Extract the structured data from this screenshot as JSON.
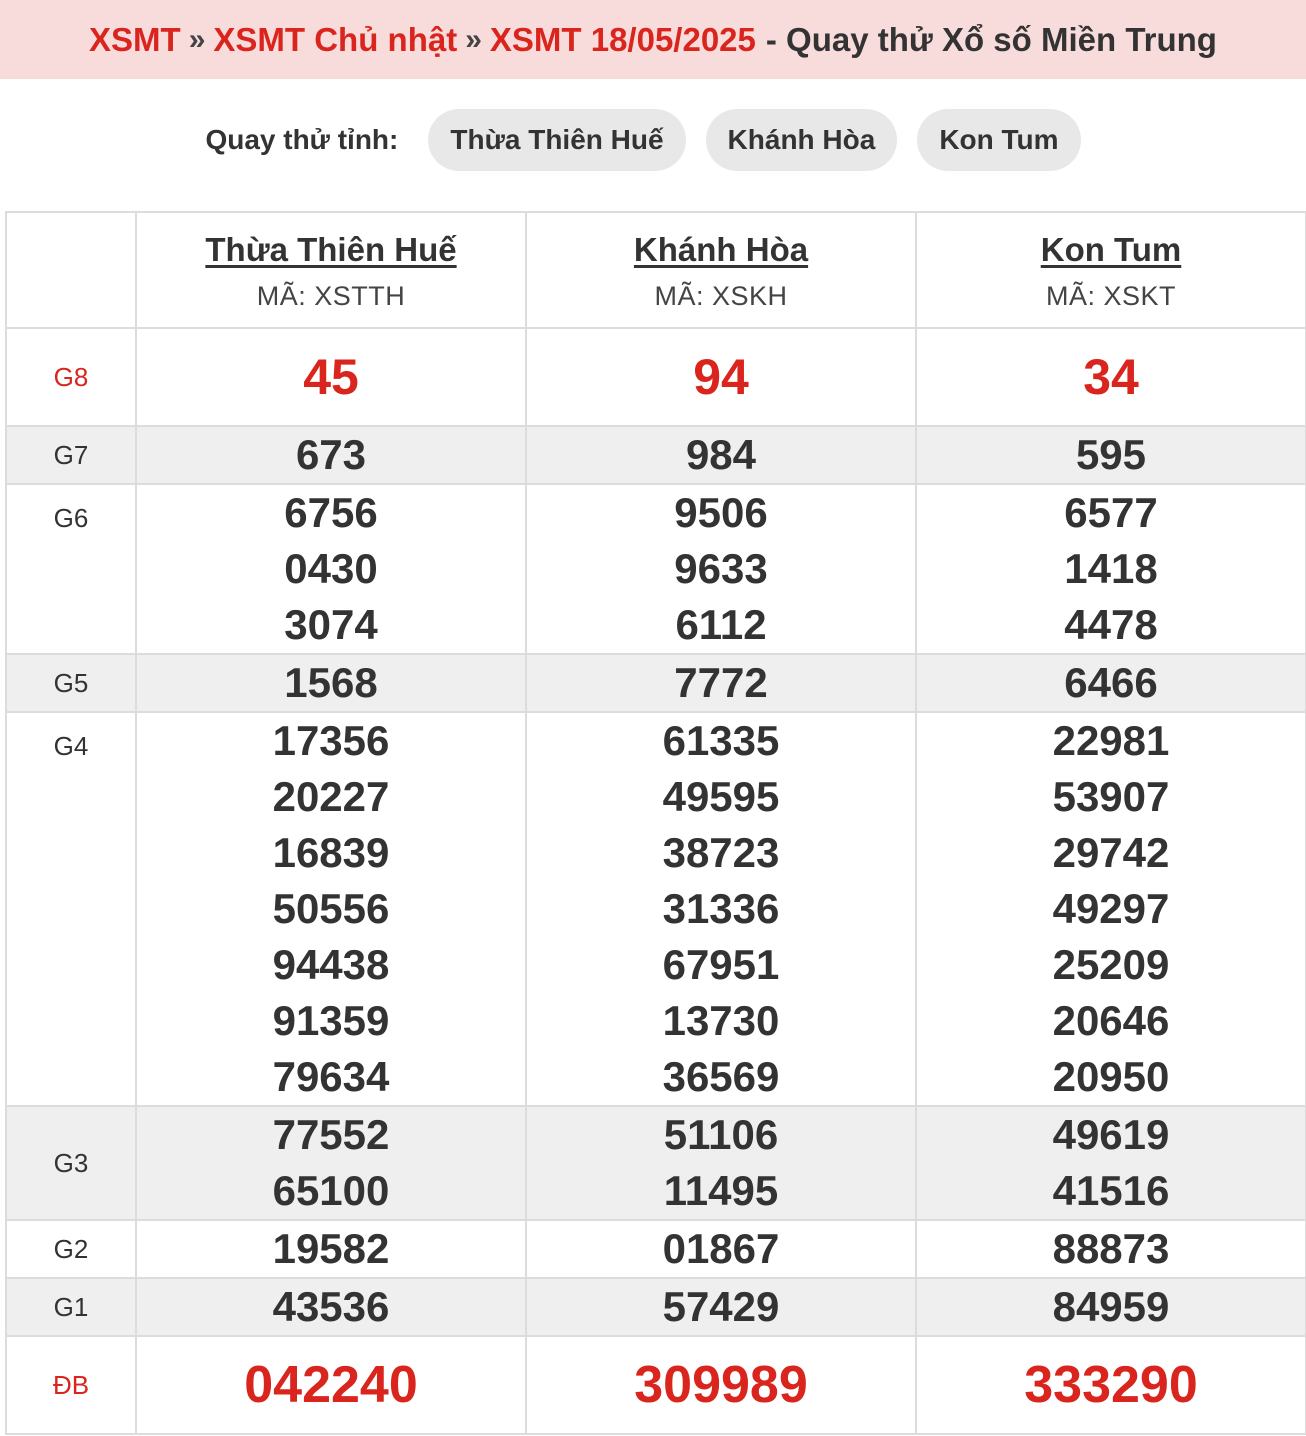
{
  "breadcrumb": {
    "home": "XSMT",
    "sep1": "»",
    "day": "XSMT Chủ nhật",
    "sep2": "»",
    "date": "XSMT 18/05/2025",
    "tail": "- Quay thử Xổ số Miền Trung"
  },
  "chips": {
    "label": "Quay thử tỉnh:",
    "items": [
      "Thừa Thiên Huế",
      "Khánh Hòa",
      "Kon Tum"
    ]
  },
  "provinces": [
    {
      "name": "Thừa Thiên Huế",
      "code": "MÃ: XSTTH"
    },
    {
      "name": "Khánh Hòa",
      "code": "MÃ: XSKH"
    },
    {
      "name": "Kon Tum",
      "code": "MÃ: XSKT"
    }
  ],
  "prizes": {
    "g8": {
      "label": "G8",
      "values": [
        "45",
        "94",
        "34"
      ]
    },
    "g7": {
      "label": "G7",
      "values": [
        "673",
        "984",
        "595"
      ]
    },
    "g6": {
      "label": "G6",
      "values": [
        [
          "6756",
          "0430",
          "3074"
        ],
        [
          "9506",
          "9633",
          "6112"
        ],
        [
          "6577",
          "1418",
          "4478"
        ]
      ]
    },
    "g5": {
      "label": "G5",
      "values": [
        "1568",
        "7772",
        "6466"
      ]
    },
    "g4": {
      "label": "G4",
      "values": [
        [
          "17356",
          "20227",
          "16839",
          "50556",
          "94438",
          "91359",
          "79634"
        ],
        [
          "61335",
          "49595",
          "38723",
          "31336",
          "67951",
          "13730",
          "36569"
        ],
        [
          "22981",
          "53907",
          "29742",
          "49297",
          "25209",
          "20646",
          "20950"
        ]
      ]
    },
    "g3": {
      "label": "G3",
      "values": [
        [
          "77552",
          "65100"
        ],
        [
          "51106",
          "11495"
        ],
        [
          "49619",
          "41516"
        ]
      ]
    },
    "g2": {
      "label": "G2",
      "values": [
        "19582",
        "01867",
        "88873"
      ]
    },
    "g1": {
      "label": "G1",
      "values": [
        "43536",
        "57429",
        "84959"
      ]
    },
    "db": {
      "label": "ĐB",
      "values": [
        "042240",
        "309989",
        "333290"
      ]
    }
  },
  "colors": {
    "accent": "#d9251d",
    "banner": "#f8dcdc",
    "shade": "#efefef",
    "chip": "#e8e8e8"
  }
}
